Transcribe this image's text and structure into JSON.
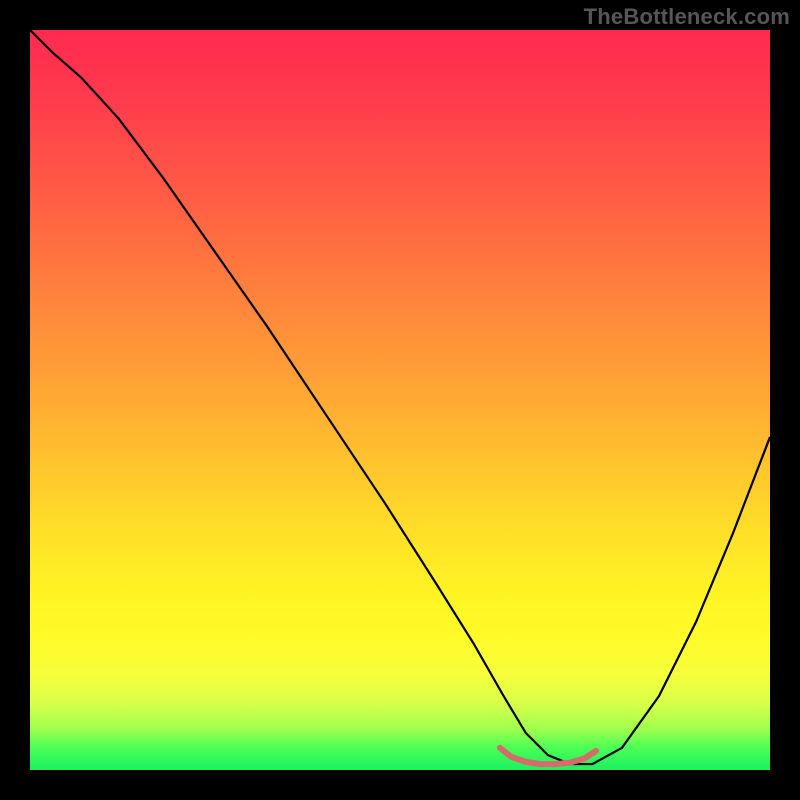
{
  "watermark": "TheBottleneck.com",
  "colors": {
    "page_bg": "#000000",
    "watermark": "#565656",
    "curve_stroke": "#000000",
    "valley_stroke": "#d76b6b",
    "gradient_top": "#ff2a4f",
    "gradient_bottom": "#18f060"
  },
  "chart_data": {
    "type": "line",
    "title": "",
    "xlabel": "",
    "ylabel": "",
    "xlim": [
      0,
      100
    ],
    "ylim": [
      0,
      100
    ],
    "grid": false,
    "legend": false,
    "series": [
      {
        "name": "bottleneck-curve",
        "stroke": "#000000",
        "stroke_width": 2.2,
        "x": [
          0,
          3,
          7,
          12,
          18,
          25,
          32,
          40,
          48,
          55,
          60,
          64,
          67,
          70,
          73,
          76,
          80,
          85,
          90,
          95,
          100
        ],
        "y": [
          100,
          97,
          93.5,
          88,
          80,
          70,
          60,
          48,
          36,
          25,
          17,
          10,
          5,
          2,
          0.8,
          0.8,
          3,
          10,
          20,
          32,
          45
        ]
      },
      {
        "name": "valley-highlight",
        "stroke": "#d76b6b",
        "stroke_width": 6,
        "linecap": "round",
        "x": [
          63.5,
          65,
          67,
          69,
          71,
          73,
          75,
          76.5
        ],
        "y": [
          3.0,
          1.8,
          1.1,
          0.8,
          0.8,
          1.0,
          1.6,
          2.6
        ]
      }
    ],
    "annotations": []
  }
}
